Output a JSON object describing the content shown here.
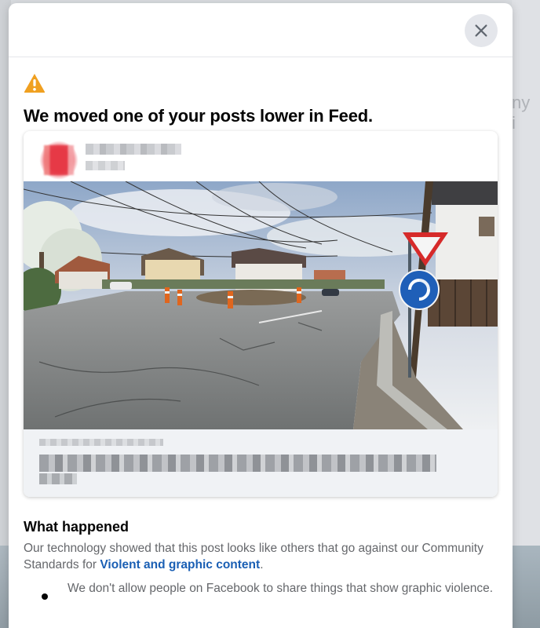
{
  "dialog": {
    "close_label": "Close",
    "title": "We moved one of your posts lower in Feed.",
    "post": {
      "info_label": "i"
    },
    "what_happened": {
      "heading": "What happened",
      "text_before": "Our technology showed that this post looks like others that go against our Community Standards for ",
      "link": "Violent and graphic content",
      "text_after": ".",
      "bullets": [
        "We don't allow people on Facebook to share things that show graphic violence."
      ]
    }
  },
  "icons": {
    "close": "close-icon",
    "warning": "warning-icon",
    "info": "info-icon"
  },
  "colors": {
    "warning": "#f0a020",
    "link": "#1a5fb4",
    "close_bg": "#e4e6eb",
    "body_text": "#65676b"
  }
}
